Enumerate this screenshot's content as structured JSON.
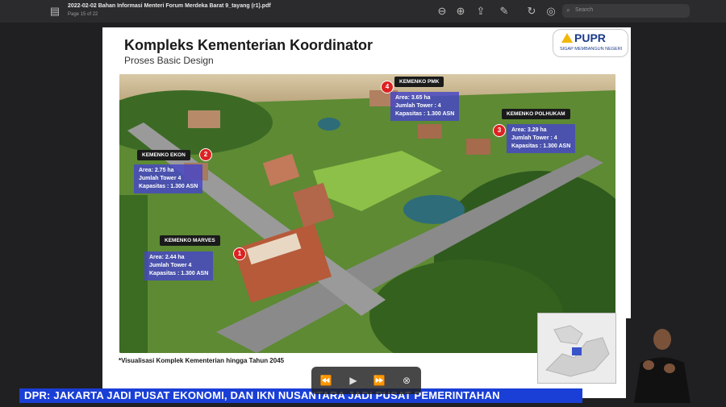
{
  "toolbar": {
    "doc_title": "2022-02-02 Bahan Informasi Menteri Forum Merdeka Barat 9_tayang (r1).pdf",
    "page_indicator": "Page 15 of 22",
    "search_placeholder": "Search",
    "icons": [
      "sidebar-icon",
      "zoom-out-icon",
      "zoom-in-icon",
      "share-icon",
      "markup-icon",
      "rotate-icon",
      "annotate-icon",
      "search-icon"
    ]
  },
  "slide": {
    "title": "Kompleks Kementerian Koordinator",
    "subtitle": "Proses Basic Design",
    "logo": {
      "name": "PUPR",
      "tagline": "SIGAP MEMBANGUN NEGERI"
    },
    "caption": "*Visualisasi Komplek Kementerian hingga Tahun 2045",
    "complexes": [
      {
        "num": "1",
        "name": "KEMENKO MARVES",
        "area": "Area: 2.44 ha",
        "towers": "Jumlah Tower 4",
        "capacity": "Kapasitas : 1.300 ASN"
      },
      {
        "num": "2",
        "name": "KEMENKO EKON",
        "area": "Area: 2.75 ha",
        "towers": "Jumlah Tower 4",
        "capacity": "Kapasitas : 1.300 ASN"
      },
      {
        "num": "3",
        "name": "KEMENKO POLHUKAM",
        "area": "Area: 3.29 ha",
        "towers": "Jumlah Tower : 4",
        "capacity": "Kapasitas : 1.300 ASN"
      },
      {
        "num": "4",
        "name": "KEMENKO PMK",
        "area": "Area: 3.65 ha",
        "towers": "Jumlah Tower : 4",
        "capacity": "Kapasitas : 1.300 ASN"
      }
    ]
  },
  "ticker": {
    "text": "DPR: JAKARTA JADI PUSAT EKONOMI, DAN IKN NUSANTARA JADI PUSAT PEMERINTAHAN"
  },
  "player": {
    "controls": [
      "rewind-icon",
      "play-icon",
      "fast-forward-icon",
      "close-icon"
    ]
  },
  "colors": {
    "ticker_bg": "#1a3fd6",
    "info_bg": "#4646c8",
    "marker": "#dd2222",
    "toolbar": "#2b2b2d"
  }
}
